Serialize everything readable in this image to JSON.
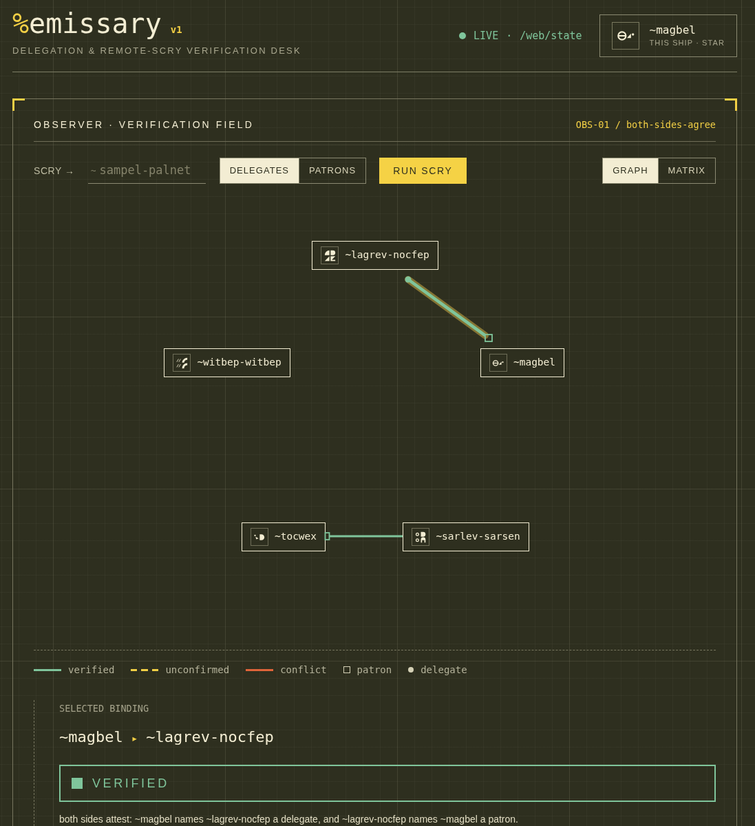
{
  "header": {
    "logo_mark": "%",
    "logo_name": "emissary",
    "version": "v1",
    "subtitle": "DELEGATION & REMOTE-SCRY VERIFICATION DESK",
    "status": {
      "live": true,
      "label": "LIVE",
      "separator": "·",
      "path": "/web/state"
    },
    "ship": {
      "name": "~magbel",
      "role": "THIS SHIP · STAR"
    }
  },
  "panel": {
    "title": "OBSERVER · VERIFICATION FIELD",
    "reference": "OBS-01 / both-sides-agree",
    "scry": {
      "label": "SCRY →",
      "field": {
        "prefix": "~",
        "placeholder": "sampel-palnet"
      },
      "direction_tabs": [
        {
          "label": "DELEGATES",
          "selected": true
        },
        {
          "label": "PATRONS",
          "selected": false
        }
      ],
      "run_button": "RUN SCRY",
      "view_tabs": [
        {
          "label": "GRAPH",
          "selected": true
        },
        {
          "label": "MATRIX",
          "selected": false
        }
      ]
    },
    "graph": {
      "nodes": [
        {
          "name": "~lagrev-nocfep"
        },
        {
          "name": "~witbep-witbep"
        },
        {
          "name": "~magbel"
        },
        {
          "name": "~tocwex"
        },
        {
          "name": "~sarlev-sarsen"
        }
      ],
      "edges": [
        {
          "verified": true,
          "selected": true
        },
        {
          "verified": true,
          "selected": false
        }
      ]
    },
    "legend": [
      {
        "kind": "line",
        "color": "#7fc59b",
        "label": "verified"
      },
      {
        "kind": "dashed",
        "color": "#f2cf45",
        "label": "unconfirmed"
      },
      {
        "kind": "line",
        "color": "#e0643a",
        "label": "conflict"
      },
      {
        "kind": "square",
        "label": "patron"
      },
      {
        "kind": "dot",
        "label": "delegate"
      }
    ],
    "selected_binding": {
      "label": "SELECTED BINDING",
      "patron": "~magbel",
      "arrow": "▸",
      "delegate": "~lagrev-nocfep",
      "verified": true,
      "status_label": "VERIFIED",
      "description": "both sides attest: ~magbel names ~lagrev-nocfep a delegate, and ~lagrev-nocfep names ~magbel a patron."
    }
  }
}
